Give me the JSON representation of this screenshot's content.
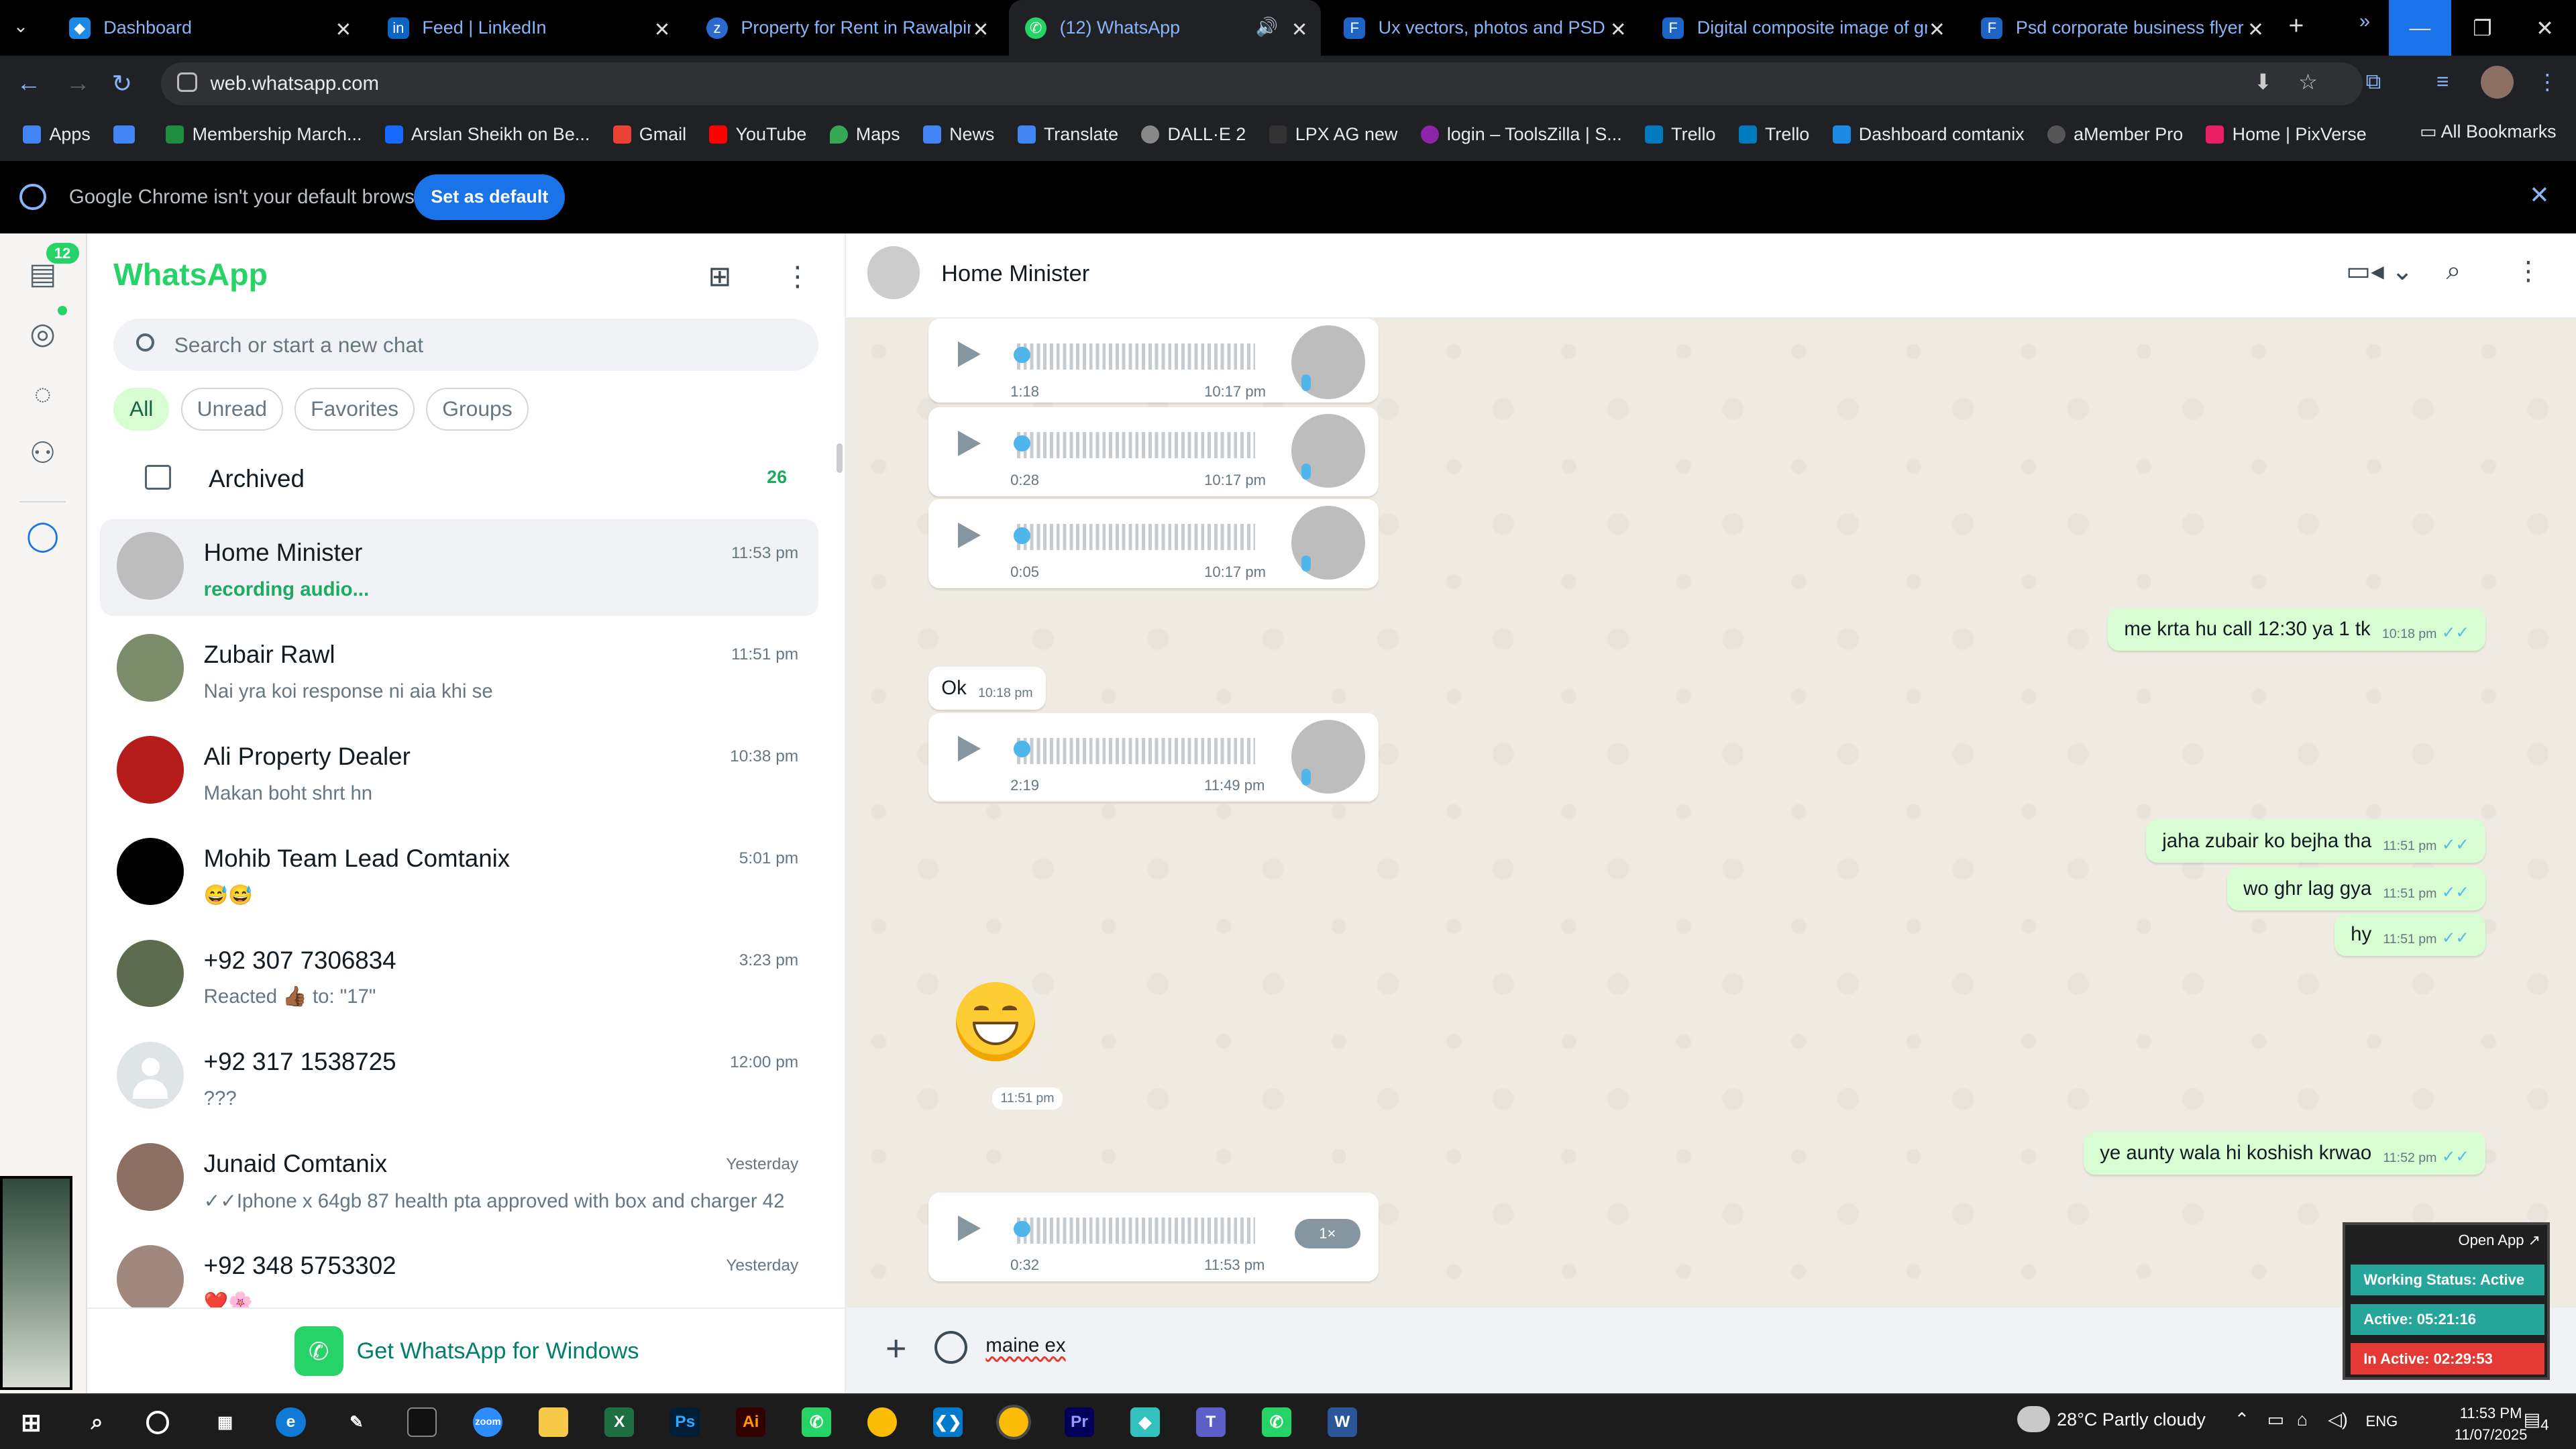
{
  "browser": {
    "tabs": [
      {
        "title": "Dashboard",
        "color": "#1e88e5",
        "icon": "dashboard-favicon"
      },
      {
        "title": "Feed | LinkedIn",
        "color": "#0a66c2",
        "icon": "linkedin-favicon"
      },
      {
        "title": "Property for Rent in Rawalpindi",
        "color": "#2b6bd1",
        "icon": "zameen-favicon"
      },
      {
        "title": "(12) WhatsApp",
        "color": "#25d366",
        "icon": "whatsapp-favicon"
      },
      {
        "title": "Ux vectors, photos and PSD files",
        "color": "#1e63c6",
        "icon": "freepik-favicon"
      },
      {
        "title": "Digital composite image of gray",
        "color": "#1e63c6",
        "icon": "freepik-favicon"
      },
      {
        "title": "Psd corporate business flyer de",
        "color": "#1e63c6",
        "icon": "freepik-favicon"
      }
    ],
    "url": "web.whatsapp.com",
    "bookmarks": [
      {
        "label": "Apps",
        "color": "#4285f4"
      },
      {
        "label": "",
        "color": "#4285f4"
      },
      {
        "label": "Membership March...",
        "color": "#1e8e3e"
      },
      {
        "label": "Arslan Sheikh on Be...",
        "color": "#1769ff"
      },
      {
        "label": "Gmail",
        "color": "#ea4335"
      },
      {
        "label": "YouTube",
        "color": "#ff0000"
      },
      {
        "label": "Maps",
        "color": "#34a853"
      },
      {
        "label": "News",
        "color": "#4285f4"
      },
      {
        "label": "Translate",
        "color": "#4285f4"
      },
      {
        "label": "DALL·E 2",
        "color": "#888888"
      },
      {
        "label": "LPX AG new",
        "color": "#333333"
      },
      {
        "label": "login – ToolsZilla | S...",
        "color": "#8e24aa"
      },
      {
        "label": "Trello",
        "color": "#0079bf"
      },
      {
        "label": "Trello",
        "color": "#0079bf"
      },
      {
        "label": "Dashboard comtanix",
        "color": "#1e88e5"
      },
      {
        "label": "aMember Pro",
        "color": "#555555"
      },
      {
        "label": "Home | PixVerse",
        "color": "#e91e63"
      }
    ],
    "bookmarks_more": "»",
    "all_bookmarks": "All Bookmarks",
    "infobar": {
      "message": "Google Chrome isn't your default browser",
      "button": "Set as default"
    }
  },
  "whatsapp": {
    "title": "WhatsApp",
    "unread_badge": "12",
    "search_placeholder": "Search or start a new chat",
    "filters": [
      "All",
      "Unread",
      "Favorites",
      "Groups"
    ],
    "archived": {
      "label": "Archived",
      "count": "26"
    },
    "chats": [
      {
        "name": "Home Minister",
        "preview": "recording audio...",
        "time": "11:53 pm",
        "avatar": "#9e9e9e"
      },
      {
        "name": "Zubair Rawl",
        "preview": "Nai yra koi response ni aia khi se",
        "time": "11:51 pm",
        "avatar": "#7a8c6a"
      },
      {
        "name": "Ali Property Dealer",
        "preview": "Makan boht shrt hn",
        "time": "10:38 pm",
        "avatar": "#b71c1c"
      },
      {
        "name": "Mohib Team Lead Comtanix",
        "preview": "😅😅",
        "time": "5:01 pm",
        "avatar": "#000000"
      },
      {
        "name": "+92 307 7306834",
        "preview": "Reacted 👍🏾 to: \"17\"",
        "time": "3:23 pm",
        "avatar": "#5d6b4e"
      },
      {
        "name": "+92 317 1538725",
        "preview": "???",
        "time": "12:00 pm",
        "avatar": "#dfe5e7"
      },
      {
        "name": "Junaid Comtanix",
        "preview": "✓✓Iphone x 64gb 87 health pta approved with box and charger   42 t...",
        "time": "Yesterday",
        "avatar": "#8d6e63"
      },
      {
        "name": "+92 348 5753302",
        "preview": "❤️🌸",
        "time": "Yesterday",
        "avatar": "#a1887f"
      }
    ],
    "get_app": "Get WhatsApp for Windows",
    "conversation": {
      "contact": "Home Minister",
      "voice_notes": [
        {
          "duration": "1:18",
          "time": "10:17 pm"
        },
        {
          "duration": "0:28",
          "time": "10:17 pm"
        },
        {
          "duration": "0:05",
          "time": "10:17 pm"
        },
        {
          "duration": "2:19",
          "time": "11:49 pm"
        },
        {
          "duration": "0:32",
          "time": "11:53 pm",
          "speed": "1×"
        }
      ],
      "outgoing": [
        {
          "text": "me krta hu call 12:30 ya 1 tk",
          "time": "10:18 pm"
        },
        {
          "text": "jaha zubair ko bejha tha",
          "time": "11:51 pm"
        },
        {
          "text": "wo ghr lag gya",
          "time": "11:51 pm"
        },
        {
          "text": "hy",
          "time": "11:51 pm"
        },
        {
          "text": "ye aunty wala hi koshish krwao",
          "time": "11:52 pm"
        }
      ],
      "incoming": [
        {
          "text": "Ok",
          "time": "10:18 pm"
        }
      ],
      "emoji_time": "11:51 pm",
      "draft": "maine ex"
    }
  },
  "tracker": {
    "open_app": "Open App ↗",
    "working": "Working Status: Active",
    "active": "Active: 05:21:16",
    "inactive": "In Active: 02:29:53",
    "colors": {
      "working": "#26a69a",
      "active": "#26a69a",
      "inactive": "#e53935"
    }
  },
  "taskbar": {
    "weather": "28°C  Partly cloudy",
    "lang": "ENG",
    "time": "11:53 PM",
    "date": "11/07/2025",
    "notif": "4"
  }
}
